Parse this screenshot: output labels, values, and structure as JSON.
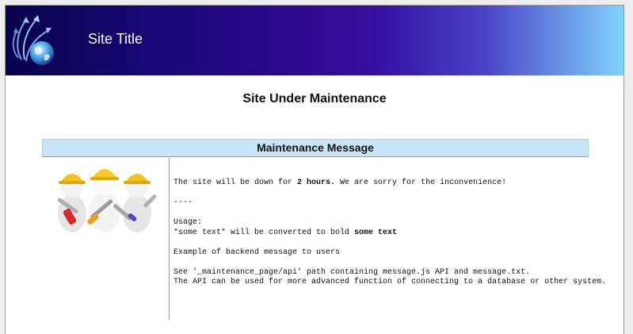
{
  "header": {
    "site_title": "Site Title",
    "gradient_colors": [
      "#08034a",
      "#2c0a8e",
      "#4a45c8",
      "#7fd2fb"
    ],
    "logo_icon": "globe-arrows-icon"
  },
  "page": {
    "heading": "Site Under Maintenance"
  },
  "panel": {
    "title": "Maintenance Message",
    "header_color": "#cbe5f8",
    "image_icon": "construction-workers-image"
  },
  "message": {
    "line1_before": "The site will be down for ",
    "line1_bold": "2 hours.",
    "line1_after": " We are sorry for the inconvenience!",
    "separator": "----",
    "usage_label": "Usage:",
    "usage_before": "*some text* will be converted to bold ",
    "usage_bold": "some text",
    "example": "Example of backend message to users",
    "see_line": "See '_maintenance_page/api' path containing message.js API and message.txt.",
    "api_line": "The API can be used for more advanced function of connecting to a database or other system."
  }
}
